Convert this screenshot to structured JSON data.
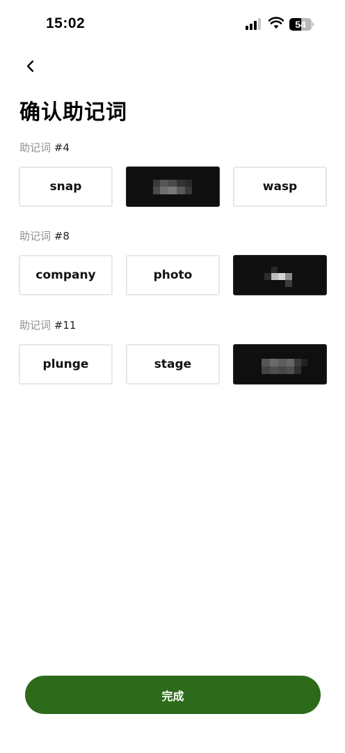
{
  "status_bar": {
    "time": "15:02",
    "battery_level": "54",
    "battery_fraction": 0.54,
    "signal_bars_active": 3,
    "signal_bars_total": 4
  },
  "header": {
    "back_icon": "chevron-left-icon",
    "title": "确认助记词"
  },
  "sections": [
    {
      "label_prefix": "助记词",
      "label_number": "#4",
      "options": [
        "snap",
        "",
        "wasp"
      ],
      "selected_index": 1
    },
    {
      "label_prefix": "助记词",
      "label_number": "#8",
      "options": [
        "company",
        "photo",
        ""
      ],
      "selected_index": 2
    },
    {
      "label_prefix": "助记词",
      "label_number": "#11",
      "options": [
        "plunge",
        "stage",
        ""
      ],
      "selected_index": 2
    }
  ],
  "footer": {
    "done_label": "完成"
  },
  "colors": {
    "primary_button": "#2d6a1a",
    "selected_word_bg": "#0f0f0f",
    "word_border": "#e7e7e7",
    "label_gray": "#8f8f8f"
  }
}
